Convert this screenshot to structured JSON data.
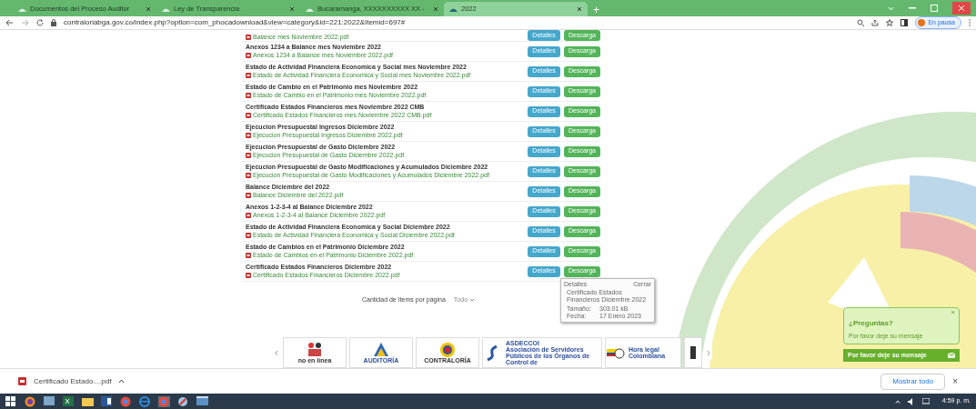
{
  "browser": {
    "tabs": [
      {
        "title": "Documentos del Proceso Auditor",
        "selected": false
      },
      {
        "title": "Ley de Transparencia",
        "selected": false
      },
      {
        "title": "Bucaramanga, XXXXXXXXXX XX -",
        "selected": false
      },
      {
        "title": "2022",
        "selected": true
      }
    ],
    "new_tab": "+",
    "address": "contraloriabga.gov.co/index.php?option=com_phocadownload&view=category&id=221:2022&Itemid=697#",
    "profile": "En pausa"
  },
  "documents": [
    {
      "file": "Balance mes Noviembre 2022.pdf",
      "details": "Detalles",
      "download": "Descarga"
    },
    {
      "title": "Anexos 1234 a Balance mes Noviembre 2022",
      "file": "Anexos 1234 a Balance mes Noviembre 2022.pdf",
      "details": "Detalles",
      "download": "Descarga"
    },
    {
      "title": "Estado de Actividad Financiera Economica y Social mes Noviembre 2022",
      "file": "Estado de Actividad Financiera Economica y Social mes Noviembre 2022.pdf",
      "details": "Detalles",
      "download": "Descarga"
    },
    {
      "title": "Estado de Cambio en el Patrimonio mes Noviembre 2022",
      "file": "Estado de Cambio en el Patrimonio mes Noviembre 2022.pdf",
      "details": "Detalles",
      "download": "Descarga"
    },
    {
      "title": "Certificado Estados Financieros mes Noviembre 2022 CMB",
      "file": "Certificado Estados Financieros mes Noviembre 2022 CMB.pdf",
      "details": "Detalles",
      "download": "Descarga"
    },
    {
      "title": "Ejecucion Presupuestal Ingresos Diciembre 2022",
      "file": "Ejecucion Presupuestal Ingresos Diciembre 2022.pdf",
      "details": "Detalles",
      "download": "Descarga"
    },
    {
      "title": "Ejecucion Presupuestal de Gasto Diciembre 2022",
      "file": "Ejecucion Presupuestal de Gasto Diciembre 2022.pdf",
      "details": "Detalles",
      "download": "Descarga"
    },
    {
      "title": "Ejecucion Presupuestal de Gasto Modificaciones y Acumulados Diciembre 2022",
      "file": "Ejecucion Presupuestal de Gasto Modificaciones y Acumulados Diciembre 2022.pdf",
      "details": "Detalles",
      "download": "Descarga"
    },
    {
      "title": "Balance Diciembre del 2022",
      "file": "Balance Diciembre del 2022.pdf",
      "details": "Detalles",
      "download": "Descarga"
    },
    {
      "title": "Anexos 1-2-3-4 al Balance Diciembre 2022",
      "file": "Anexos 1-2-3-4 al Balance Diciembre 2022.pdf",
      "details": "Detalles",
      "download": "Descarga"
    },
    {
      "title": "Estado de Actividad Financiera Economica y Social Diciembre 2022",
      "file": "Estado de Actividad Financiera Economica y Social Diciembre 2022.pdf",
      "details": "Detalles",
      "download": "Descarga"
    },
    {
      "title": "Estado de Cambios en el Patrimonio Diciembre 2022",
      "file": "Estado de Cambios en el Patrimonio Diciembre 2022.pdf",
      "details": "Detalles",
      "download": "Descarga"
    },
    {
      "title": "Certificado Estados Financieros Diciembre 2022",
      "file": "Certificado Estados Financieros Diciembre 2022.pdf",
      "details": "Detalles",
      "download": "Descarga"
    }
  ],
  "popup": {
    "heading": "Detalles",
    "close": "Cerrar",
    "name": "Certificado Estados Financieros Diciembre 2022",
    "rows": [
      {
        "label": "Tamaño:",
        "value": "303.01 kB"
      },
      {
        "label": "Fecha:",
        "value": "17 Enero 2023"
      }
    ]
  },
  "pagination": {
    "label": "Cantidad de Items por página",
    "value": "Todo"
  },
  "carousel": {
    "prev": "‹",
    "next": "›"
  },
  "logos": [
    {
      "kind": "people",
      "text": "no en línea"
    },
    {
      "kind": "auditoria",
      "text": "AUDITORÍA"
    },
    {
      "kind": "contraloria",
      "text": "CONTRALORÍA"
    },
    {
      "kind": "asdeccol",
      "text": "ASDECCOI",
      "subtext": "Asociación de Servidores Públicos de los Órganos de Control de"
    },
    {
      "kind": "hora",
      "text": "Hora legal Colombiana"
    },
    {
      "kind": "partial"
    }
  ],
  "chat": {
    "title": "¿Preguntas?",
    "subtitle": "Por favor deje su mensaje",
    "close": "×",
    "bar": "Por favor deje su mensaje"
  },
  "download_bar": {
    "file": "Certificado Estado....pdf",
    "show_all": "Mostrar todo",
    "close": "×"
  },
  "taskbar": {
    "time": "4:59 p. m."
  }
}
